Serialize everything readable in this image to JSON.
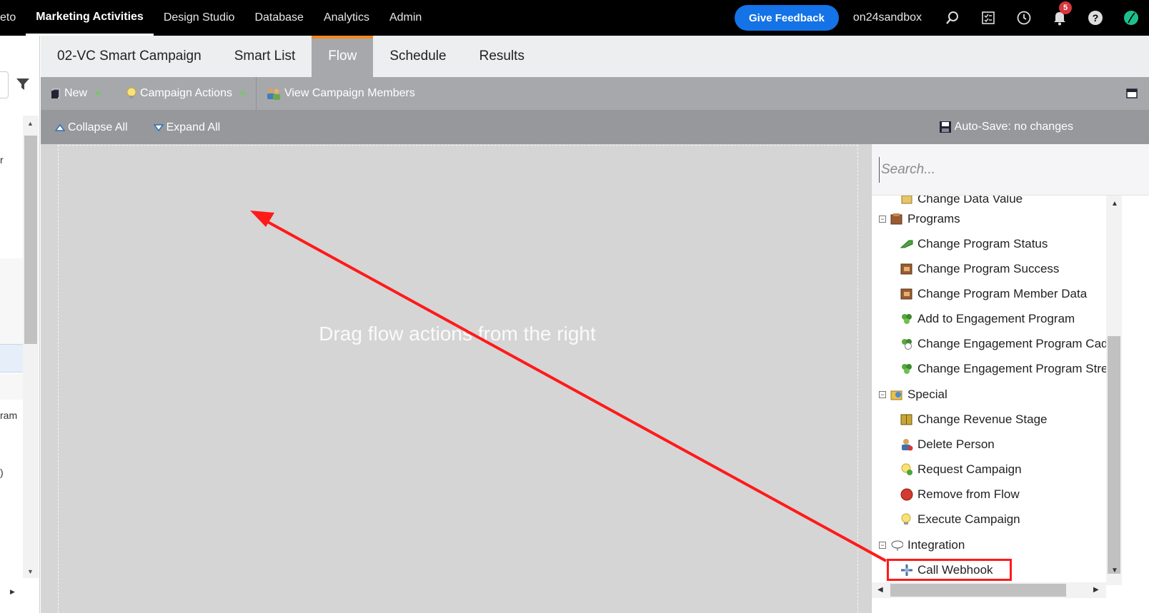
{
  "topnav": {
    "items": [
      {
        "label": "eto"
      },
      {
        "label": "Marketing Activities",
        "active": true
      },
      {
        "label": "Design Studio"
      },
      {
        "label": "Database"
      },
      {
        "label": "Analytics"
      },
      {
        "label": "Admin"
      }
    ],
    "feedback_label": "Give Feedback",
    "sandbox_label": "on24sandbox",
    "notification_count": "5",
    "icons": [
      "search-icon",
      "task-list-icon",
      "clock-icon",
      "bell-icon",
      "help-icon",
      "brand-icon"
    ]
  },
  "sidebar": {
    "fragments": [
      "r",
      "ram",
      ")"
    ]
  },
  "tabs": [
    {
      "label": "02-VC Smart Campaign"
    },
    {
      "label": "Smart List"
    },
    {
      "label": "Flow",
      "active": true
    },
    {
      "label": "Schedule"
    },
    {
      "label": "Results"
    }
  ],
  "toolbar": {
    "new_label": "New",
    "campaign_actions_label": "Campaign Actions",
    "view_members_label": "View Campaign Members"
  },
  "subbar": {
    "collapse_label": "Collapse All",
    "expand_label": "Expand All",
    "autosave_label": "Auto-Save: no changes"
  },
  "canvas": {
    "hint": "Drag flow actions from the right"
  },
  "rpanel": {
    "search_placeholder": "Search...",
    "cut_item": "Change Data Value",
    "groups": [
      {
        "label": "Programs",
        "items": [
          "Change Program Status",
          "Change Program Success",
          "Change Program Member Data",
          "Add to Engagement Program",
          "Change Engagement Program Cad",
          "Change Engagement Program Stre"
        ]
      },
      {
        "label": "Special",
        "items": [
          "Change Revenue Stage",
          "Delete Person",
          "Request Campaign",
          "Remove from Flow",
          "Execute Campaign"
        ]
      },
      {
        "label": "Integration",
        "items": [
          "Call Webhook"
        ]
      }
    ]
  },
  "colors": {
    "nav_bg": "#000000",
    "feedback_blue": "#1473e6",
    "active_tab_accent": "#f08a24",
    "toolbar_gray": "#a6a8ac",
    "canvas_gray": "#d5d5d5",
    "annotation_red": "#ff1a1a"
  }
}
